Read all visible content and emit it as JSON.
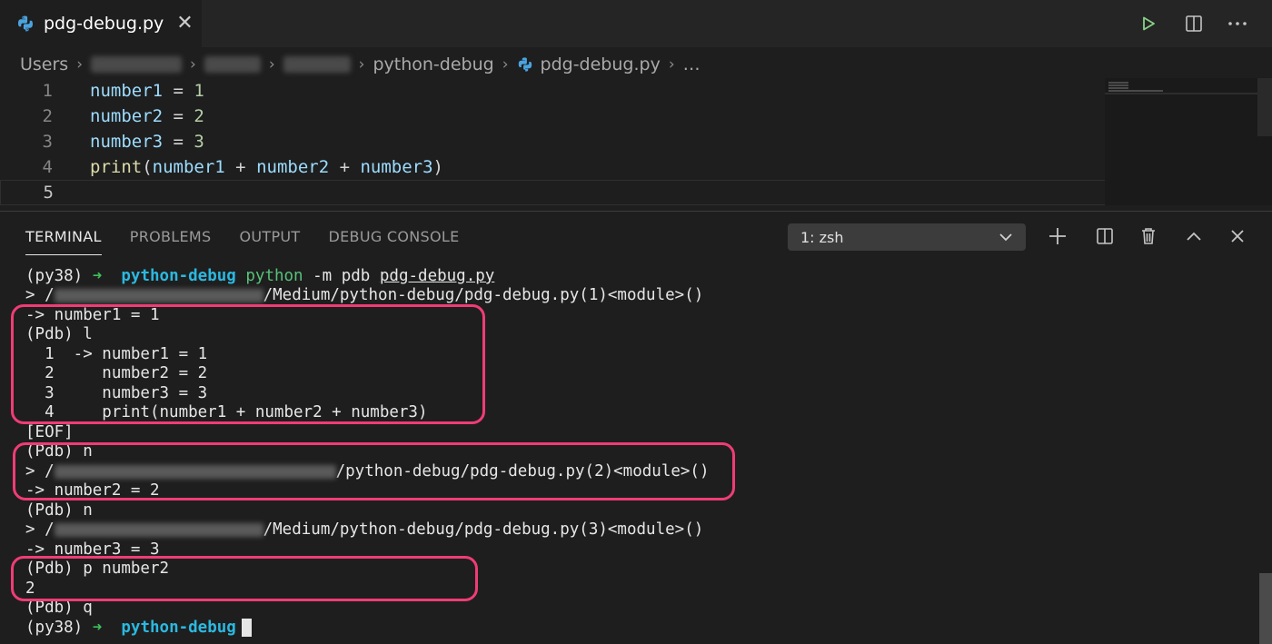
{
  "tab": {
    "title": "pdg-debug.py",
    "close_glyph": "✕"
  },
  "breadcrumb": {
    "items": [
      "Users",
      "python-debug",
      "pdg-debug.py",
      "…"
    ],
    "separator": "›"
  },
  "editor": {
    "lines": [
      {
        "num": "1",
        "tokens": [
          [
            "var",
            "number1"
          ],
          [
            "op",
            " = "
          ],
          [
            "num",
            "1"
          ]
        ]
      },
      {
        "num": "2",
        "tokens": [
          [
            "var",
            "number2"
          ],
          [
            "op",
            " = "
          ],
          [
            "num",
            "2"
          ]
        ]
      },
      {
        "num": "3",
        "tokens": [
          [
            "var",
            "number3"
          ],
          [
            "op",
            " = "
          ],
          [
            "num",
            "3"
          ]
        ]
      },
      {
        "num": "4",
        "tokens": [
          [
            "fn",
            "print"
          ],
          [
            "op",
            "("
          ],
          [
            "var",
            "number1"
          ],
          [
            "op",
            " + "
          ],
          [
            "var",
            "number2"
          ],
          [
            "op",
            " + "
          ],
          [
            "var",
            "number3"
          ],
          [
            "op",
            ")"
          ]
        ]
      },
      {
        "num": "5",
        "tokens": []
      }
    ]
  },
  "panel": {
    "tabs": [
      "TERMINAL",
      "PROBLEMS",
      "OUTPUT",
      "DEBUG CONSOLE"
    ],
    "active_tab": "TERMINAL",
    "shell": "1: zsh"
  },
  "terminal": {
    "prompt_env": "(py38)",
    "prompt_arrow": "➜",
    "prompt_dir": "python-debug",
    "command_python": "python",
    "command_args": " -m pdb ",
    "command_file": "pdg-debug.py",
    "path_suffix_1": "/Medium/python-debug/pdg-debug.py(1)<module>()",
    "path_suffix_2": "/python-debug/pdg-debug.py(2)<module>()",
    "path_suffix_3": "/Medium/python-debug/pdg-debug.py(3)<module>()",
    "lines": [
      "-> number1 = 1",
      "(Pdb) l",
      "  1  -> number1 = 1",
      "  2     number2 = 2",
      "  3     number3 = 3",
      "  4     print(number1 + number2 + number3)",
      "[EOF]",
      "(Pdb) n",
      "-> number2 = 2",
      "(Pdb) n",
      "-> number3 = 3",
      "(Pdb) p number2",
      "2",
      "(Pdb) q"
    ],
    "path_prefix": "> /"
  },
  "colors": {
    "highlight": "#f03c76",
    "accent_cyan": "#2bb8e0",
    "run_green": "#89d185"
  }
}
